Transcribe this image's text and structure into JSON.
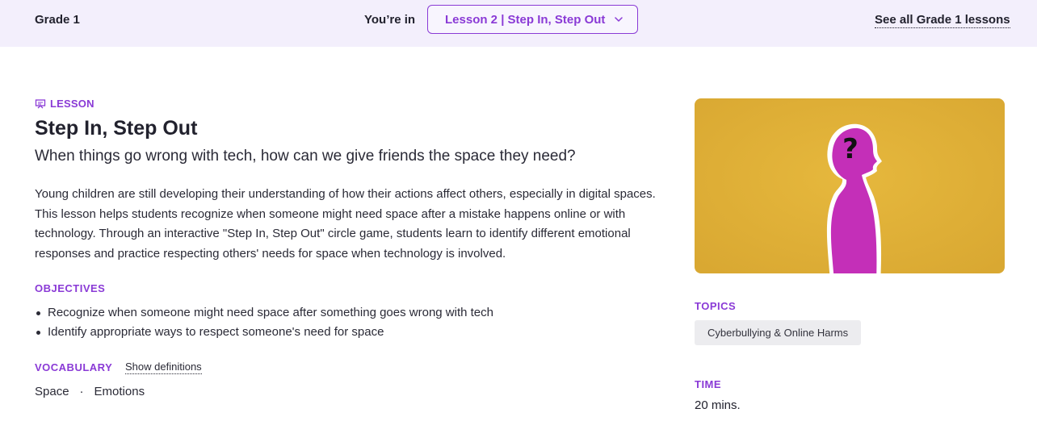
{
  "header": {
    "grade_label": "Grade 1",
    "youre_in_label": "You’re in",
    "lesson_select_value": "Lesson 2 | Step In, Step Out",
    "see_all_link": "See all Grade 1 lessons"
  },
  "lesson": {
    "tag": "LESSON",
    "title": "Step In, Step Out",
    "subtitle": "When things go wrong with tech, how can we give friends the space they need?",
    "description": "Young children are still developing their understanding of how their actions affect others, especially in digital spaces. This lesson helps students recognize when someone might need space after a mistake happens online or with technology. Through an interactive \"Step In, Step Out\" circle game, students learn to identify different emotional responses and practice respecting others' needs for space when technology is involved."
  },
  "objectives": {
    "heading": "OBJECTIVES",
    "items": [
      "Recognize when someone might need space after something goes wrong with tech",
      "Identify appropriate ways to respect someone's need for space"
    ]
  },
  "vocabulary": {
    "heading": "VOCABULARY",
    "show_definitions_label": "Show definitions",
    "words": [
      "Space",
      "Emotions"
    ],
    "separator": "·"
  },
  "sidebar": {
    "image": {
      "icon": "question-mark-silhouette",
      "background_color": "#e2b23a",
      "figure_color": "#c42fb8"
    },
    "topics_heading": "TOPICS",
    "topics": [
      "Cyberbullying & Online Harms"
    ],
    "time_heading": "TIME",
    "time_value": "20 mins."
  },
  "colors": {
    "accent": "#8a3ad6",
    "header_bg": "#f3effc",
    "chip_bg": "#ececef"
  }
}
